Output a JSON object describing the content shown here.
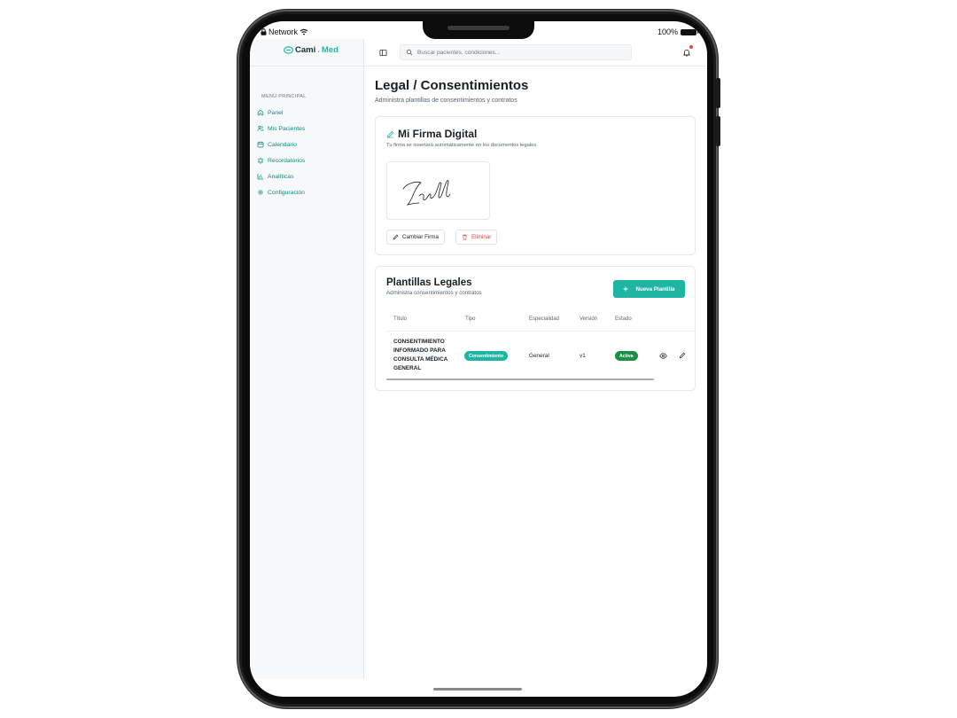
{
  "status_bar": {
    "network": "Network",
    "battery": "100%"
  },
  "brand": {
    "name_part1": "Cami",
    "name_dot": ".",
    "name_part2": "Med",
    "accent": "#1fb5a3"
  },
  "sidebar": {
    "heading": "MENÚ PRINCIPAL",
    "items": [
      {
        "label": "Panel",
        "icon": "home-icon"
      },
      {
        "label": "Mis Pacientes",
        "icon": "users-icon"
      },
      {
        "label": "Calendario",
        "icon": "calendar-icon"
      },
      {
        "label": "Recordatorios",
        "icon": "alarm-icon"
      },
      {
        "label": "Analíticas",
        "icon": "bar-chart-icon"
      },
      {
        "label": "Configuración",
        "icon": "gear-icon"
      }
    ]
  },
  "topbar": {
    "search_placeholder": "Buscar pacientes, condiciones..."
  },
  "page": {
    "title": "Legal / Consentimientos",
    "subtitle": "Administra plantillas de consentimientos y contratos"
  },
  "signature": {
    "title": "Mi Firma Digital",
    "description": "Tu firma se insertará automáticamente en los documentos legales",
    "change_label": "Cambiar Firma",
    "delete_label": "Eliminar"
  },
  "templates": {
    "title": "Plantillas Legales",
    "description": "Administra consentimientos y contratos",
    "new_label": "Nueva Plantilla",
    "columns": [
      "Título",
      "Tipo",
      "Especialidad",
      "Versión",
      "Estado"
    ],
    "rows": [
      {
        "title": "CONSENTIMIENTO INFORMADO PARA CONSULTA MÉDICA GENERAL",
        "type": "Consentimiento",
        "specialty": "General",
        "version": "v1",
        "status": "Activa"
      }
    ]
  },
  "colors": {
    "accent": "#1fb5a3",
    "status_active": "#1a8f45",
    "danger": "#e03c3c"
  }
}
